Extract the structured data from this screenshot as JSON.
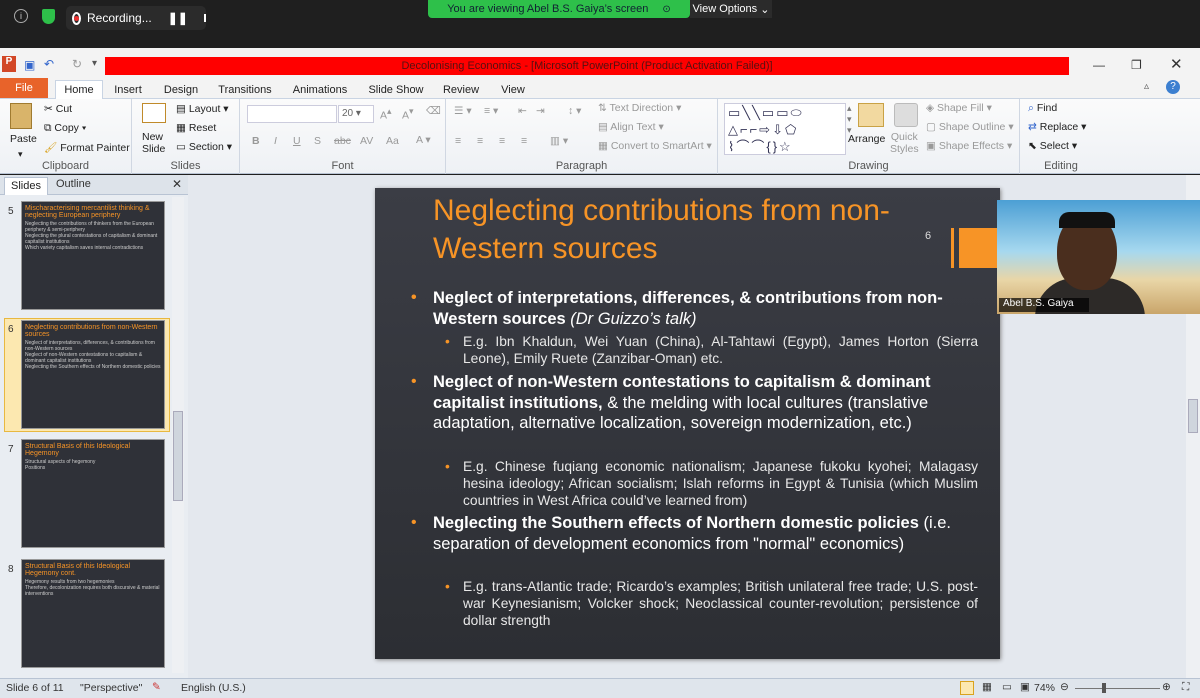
{
  "zoom": {
    "recording": "Recording...",
    "viewing": "You are viewing Abel B.S. Gaiya’s screen",
    "view_options": "View Options"
  },
  "window": {
    "title": "Decolonising Economics - [Microsoft PowerPoint (Product Activation Failed)]"
  },
  "tabs": [
    "File",
    "Home",
    "Insert",
    "Design",
    "Transitions",
    "Animations",
    "Slide Show",
    "Review",
    "View"
  ],
  "ribbon": {
    "clipboard": {
      "label": "Clipboard",
      "paste": "Paste",
      "cut": "Cut",
      "copy": "Copy",
      "format_painter": "Format Painter"
    },
    "slides": {
      "label": "Slides",
      "new_slide": "New\nSlide",
      "layout": "Layout",
      "reset": "Reset",
      "section": "Section"
    },
    "font": {
      "label": "Font",
      "size": "20"
    },
    "paragraph": {
      "label": "Paragraph",
      "text_direction": "Text Direction",
      "align_text": "Align Text",
      "smartart": "Convert to SmartArt"
    },
    "drawing": {
      "label": "Drawing",
      "arrange": "Arrange",
      "quick_styles": "Quick\nStyles",
      "shape_fill": "Shape Fill",
      "shape_outline": "Shape Outline",
      "shape_effects": "Shape Effects"
    },
    "editing": {
      "label": "Editing",
      "find": "Find",
      "replace": "Replace",
      "select": "Select"
    }
  },
  "pane": {
    "tabs": [
      "Slides",
      "Outline"
    ],
    "thumbs": [
      {
        "num": "5",
        "title": "Mischaracterising mercantilist thinking & neglecting European periphery",
        "lines": [
          "Neglecting the contributions of thinkers from the European periphery & semi-periphery",
          "Neglecting the plural contestations of capitalism & dominant capitalist institutions",
          "Which variety capitalism saves internal contradictions"
        ]
      },
      {
        "num": "6",
        "title": "Neglecting contributions from non-Western sources",
        "lines": [
          "Neglect of interpretations, differences, & contributions from non-Western sources",
          "Neglect of non-Western contestations to capitalism & dominant capitalist institutions",
          "Neglecting the Southern effects of Northern domestic policies"
        ]
      },
      {
        "num": "7",
        "title": "Structural Basis of this Ideological Hegemony",
        "lines": [
          "Structural aspects of hegemony",
          "Positions"
        ]
      },
      {
        "num": "8",
        "title": "Structural Basis of this Ideological Hegemony cont.",
        "lines": [
          "Hegemony results from two hegemonies",
          "Therefore, decolonization requires both discursive & material interventions"
        ]
      }
    ]
  },
  "slide": {
    "title": "Neglecting contributions from non-Western sources",
    "number": "6",
    "b1": "Neglect of interpretations, differences, & contributions from non-Western sources",
    "b1_paren": "(Dr Guizzo’s talk)",
    "b1_sub": "E.g. Ibn Khaldun, Wei Yuan (China), Al-Tahtawi (Egypt), James Horton (Sierra Leone), Emily Ruete (Zanzibar-Oman) etc.",
    "b2": "Neglect of non-Western contestations to capitalism & dominant capitalist institutions,",
    "b2_rest": "& the melding with local cultures (translative adaptation, alternative localization, sovereign modernization, etc.)",
    "b2_sub": "E.g. Chinese fuqiang economic nationalism; Japanese fukoku kyohei; Malagasy hesina ideology; African socialism; Islah reforms in Egypt & Tunisia (which Muslim countries in West Africa could’ve learned from)",
    "b3": "Neglecting the Southern effects of Northern domestic policies",
    "b3_rest": "(i.e. separation of development economics from \"normal\" economics)",
    "b3_sub": "E.g. trans-Atlantic trade; Ricardo’s examples; British unilateral free trade; U.S. post-war Keynesianism; Volcker shock; Neoclassical counter-revolution; persistence of dollar strength"
  },
  "webcam": {
    "name": "Abel B.S. Gaiya"
  },
  "status": {
    "slide": "Slide 6 of 11",
    "theme": "\"Perspective\"",
    "lang": "English (U.S.)",
    "zoom": "74%"
  },
  "colors": {
    "accent": "#f79426",
    "file_tab": "#e8632a",
    "zoom_green": "#2ec04a",
    "title_red": "#ff0000"
  }
}
